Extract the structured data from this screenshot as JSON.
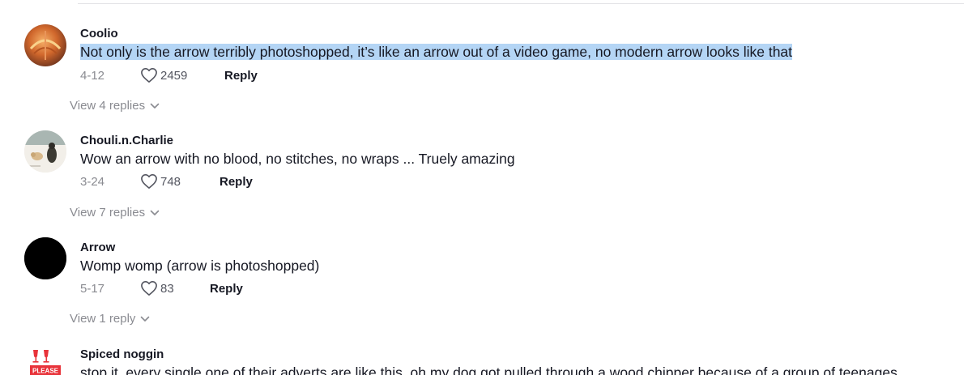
{
  "comments": [
    {
      "username": "Coolio",
      "text": "Not only is the arrow terribly photoshopped, it’s like an arrow out of a video game, no modern arrow looks like that",
      "date": "4-12",
      "likes": "2459",
      "reply_label": "Reply",
      "view_replies": "View 4 replies",
      "highlighted": true
    },
    {
      "username": "Chouli.n.Charlie",
      "text": "Wow an arrow with no blood, no stitches, no wraps ... Truely amazing",
      "date": "3-24",
      "likes": "748",
      "reply_label": "Reply",
      "view_replies": "View 7 replies"
    },
    {
      "username": "Arrow",
      "text": "Womp womp (arrow is photoshopped)",
      "date": "5-17",
      "likes": "83",
      "reply_label": "Reply",
      "view_replies": "View 1 reply"
    },
    {
      "username": "Spiced noggin",
      "text": "stop it, every single one of their adverts are like this, oh my dog got pulled through a wood chipper because of a group of teenages",
      "avatar_text": "PLEASE"
    }
  ],
  "colors": {
    "highlight": "#b4d5f5",
    "muted": "#8a8b91",
    "primary_text": "#161823",
    "avatar_badge_red": "#e8333a"
  },
  "icons": {
    "like": "heart-outline-icon",
    "expand": "chevron-down-icon"
  }
}
